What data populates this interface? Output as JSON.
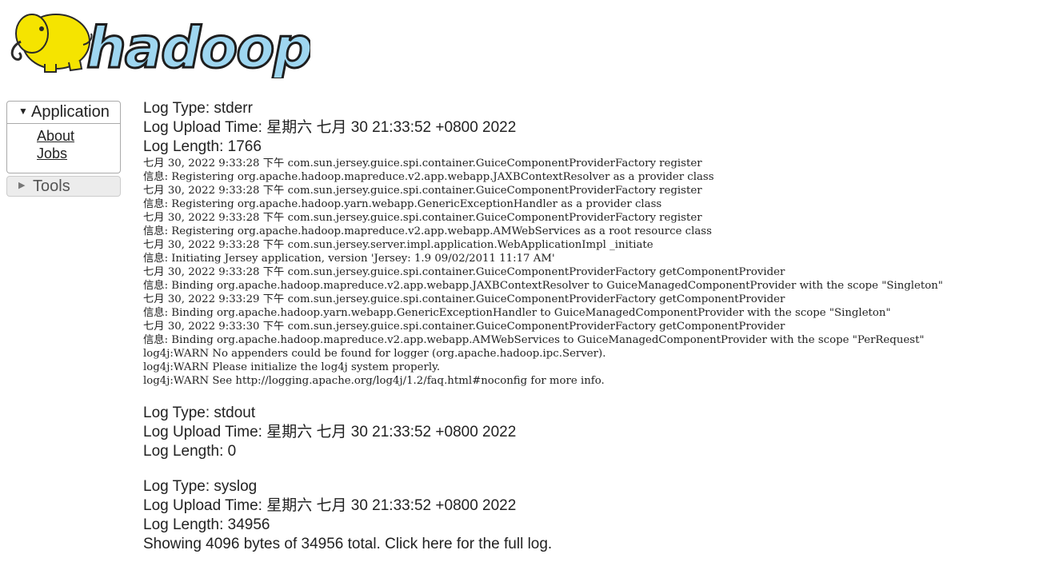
{
  "logo": {
    "text": "hadoop"
  },
  "sidebar": {
    "application": {
      "label": "Application",
      "items": [
        {
          "label": "About"
        },
        {
          "label": "Jobs"
        }
      ]
    },
    "tools": {
      "label": "Tools"
    }
  },
  "logs": [
    {
      "type": "Log Type: stderr",
      "upload_time": "Log Upload Time: 星期六 七月 30 21:33:52 +0800 2022",
      "length": "Log Length: 1766",
      "lines": [
        "七月 30, 2022 9:33:28 下午 com.sun.jersey.guice.spi.container.GuiceComponentProviderFactory register",
        "信息: Registering org.apache.hadoop.mapreduce.v2.app.webapp.JAXBContextResolver as a provider class",
        "七月 30, 2022 9:33:28 下午 com.sun.jersey.guice.spi.container.GuiceComponentProviderFactory register",
        "信息: Registering org.apache.hadoop.yarn.webapp.GenericExceptionHandler as a provider class",
        "七月 30, 2022 9:33:28 下午 com.sun.jersey.guice.spi.container.GuiceComponentProviderFactory register",
        "信息: Registering org.apache.hadoop.mapreduce.v2.app.webapp.AMWebServices as a root resource class",
        "七月 30, 2022 9:33:28 下午 com.sun.jersey.server.impl.application.WebApplicationImpl _initiate",
        "信息: Initiating Jersey application, version 'Jersey: 1.9 09/02/2011 11:17 AM'",
        "七月 30, 2022 9:33:28 下午 com.sun.jersey.guice.spi.container.GuiceComponentProviderFactory getComponentProvider",
        "信息: Binding org.apache.hadoop.mapreduce.v2.app.webapp.JAXBContextResolver to GuiceManagedComponentProvider with the scope \"Singleton\"",
        "七月 30, 2022 9:33:29 下午 com.sun.jersey.guice.spi.container.GuiceComponentProviderFactory getComponentProvider",
        "信息: Binding org.apache.hadoop.yarn.webapp.GenericExceptionHandler to GuiceManagedComponentProvider with the scope \"Singleton\"",
        "七月 30, 2022 9:33:30 下午 com.sun.jersey.guice.spi.container.GuiceComponentProviderFactory getComponentProvider",
        "信息: Binding org.apache.hadoop.mapreduce.v2.app.webapp.AMWebServices to GuiceManagedComponentProvider with the scope \"PerRequest\"",
        "log4j:WARN No appenders could be found for logger (org.apache.hadoop.ipc.Server).",
        "log4j:WARN Please initialize the log4j system properly.",
        "log4j:WARN See http://logging.apache.org/log4j/1.2/faq.html#noconfig for more info."
      ]
    },
    {
      "type": "Log Type: stdout",
      "upload_time": "Log Upload Time: 星期六 七月 30 21:33:52 +0800 2022",
      "length": "Log Length: 0",
      "lines": []
    },
    {
      "type": "Log Type: syslog",
      "upload_time": "Log Upload Time: 星期六 七月 30 21:33:52 +0800 2022",
      "length": "Log Length: 34956",
      "note": "Showing 4096 bytes of 34956 total. Click here for the full log.",
      "lines": []
    }
  ]
}
